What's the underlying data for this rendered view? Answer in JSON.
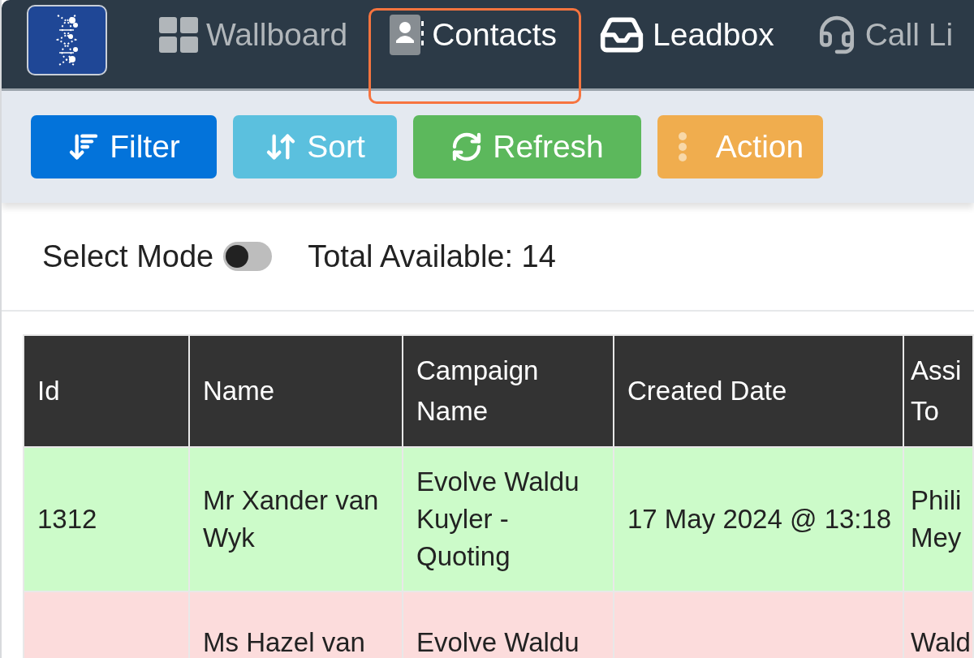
{
  "nav": {
    "items": [
      {
        "label": "Wallboard",
        "muted": true,
        "highlighted": false
      },
      {
        "label": "Contacts",
        "muted": false,
        "highlighted": true
      },
      {
        "label": "Leadbox",
        "muted": false,
        "highlighted": false
      },
      {
        "label": "Call Li",
        "muted": true,
        "highlighted": false
      }
    ]
  },
  "toolbar": {
    "buttons": [
      {
        "label": "Filter",
        "kind": "filter"
      },
      {
        "label": "Sort",
        "kind": "sort"
      },
      {
        "label": "Refresh",
        "kind": "refresh"
      },
      {
        "label": "Action",
        "kind": "action"
      }
    ]
  },
  "select_mode": {
    "label": "Select Mode",
    "on": false
  },
  "total": "Total Available: 14",
  "table": {
    "columns": [
      "Id",
      "Name",
      "Campaign Name",
      "Created Date",
      "Assi To"
    ],
    "rows": [
      {
        "color": "#ccfbc9",
        "cells": [
          "1312",
          "Mr Xander van Wyk",
          "Evolve Waldu Kuyler - Quoting",
          "17 May 2024 @ 13:18",
          "Phili Mey"
        ]
      },
      {
        "color": "#fcdcdc",
        "cells": [
          "",
          "Ms Hazel van",
          "Evolve Waldu",
          "",
          "Wald"
        ]
      }
    ]
  }
}
